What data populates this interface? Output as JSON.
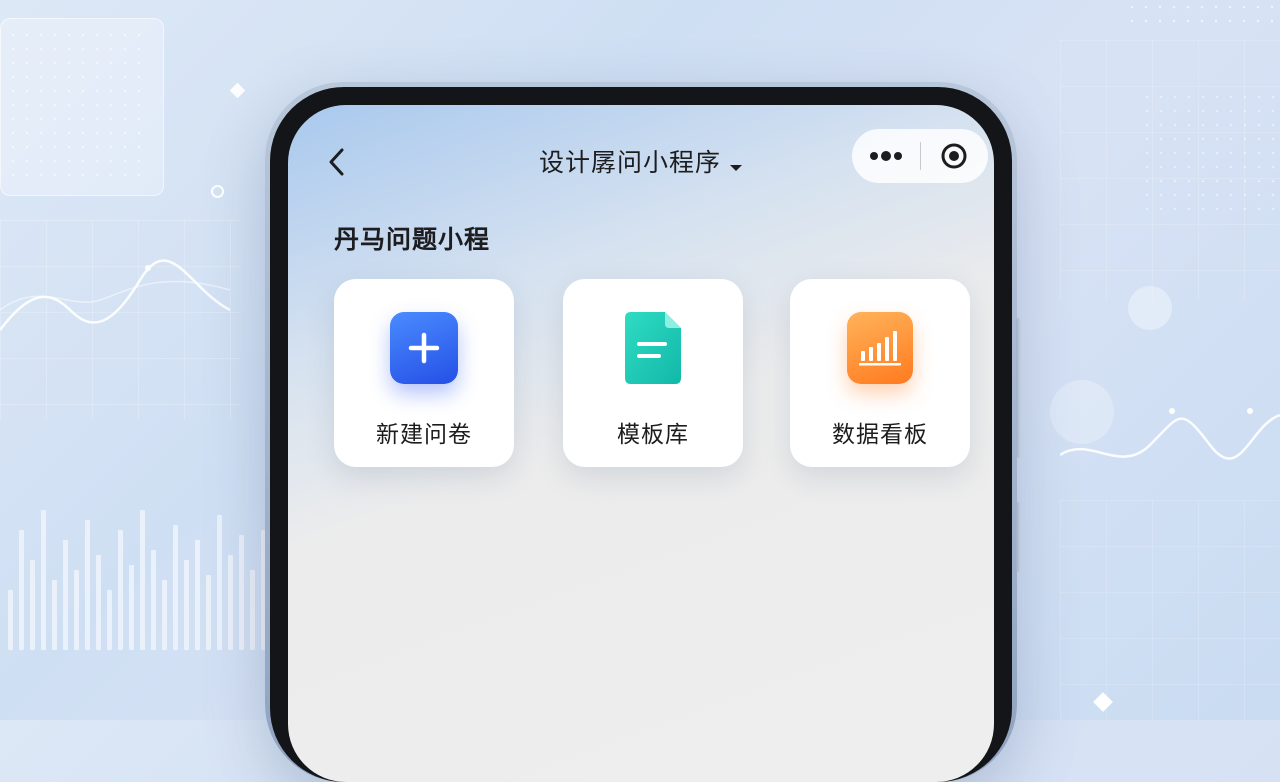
{
  "nav": {
    "title": "设计孱问小程序",
    "back_icon": "chevron-left-icon",
    "more_icon": "more-dots-icon",
    "close_icon": "target-circle-icon"
  },
  "section": {
    "title": "丹马问题小程"
  },
  "cards": [
    {
      "label": "新建问卷",
      "icon": "plus-icon",
      "color": "#2f62f0"
    },
    {
      "label": "模板库",
      "icon": "document-icon",
      "color": "#1fc8b0"
    },
    {
      "label": "数据看板",
      "icon": "bar-chart-icon",
      "color": "#ff8a2a"
    }
  ],
  "colors": {
    "accent_blue": "#2f62f0",
    "accent_teal": "#1fc8b0",
    "accent_orange": "#ff8a2a"
  }
}
